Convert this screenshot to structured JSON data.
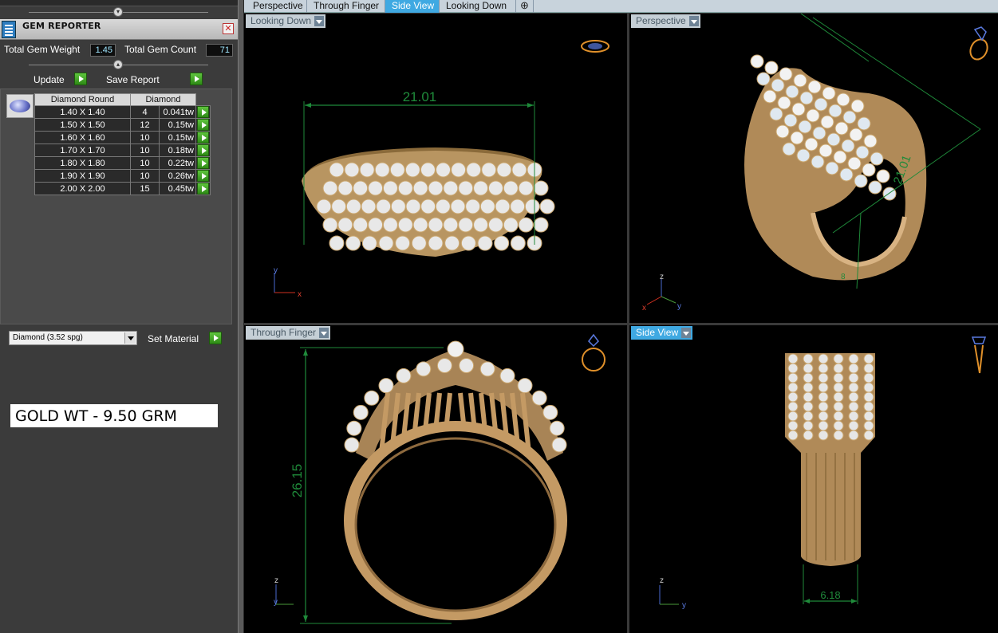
{
  "panel": {
    "title": "GEM REPORTER",
    "close_glyph": "✕",
    "total_weight_label": "Total Gem Weight",
    "total_weight_value": "1.45",
    "total_count_label": "Total Gem Count",
    "total_count_value": "71",
    "update_label": "Update",
    "save_report_label": "Save Report"
  },
  "gem_table": {
    "headers": [
      "Diamond Round",
      "Diamond"
    ],
    "rows": [
      {
        "size": "1.40 X 1.40",
        "count": "4",
        "weight": "0.041tw"
      },
      {
        "size": "1.50 X 1.50",
        "count": "12",
        "weight": "0.15tw"
      },
      {
        "size": "1.60 X 1.60",
        "count": "10",
        "weight": "0.15tw"
      },
      {
        "size": "1.70 X 1.70",
        "count": "10",
        "weight": "0.18tw"
      },
      {
        "size": "1.80 X 1.80",
        "count": "10",
        "weight": "0.22tw"
      },
      {
        "size": "1.90 X 1.90",
        "count": "10",
        "weight": "0.26tw"
      },
      {
        "size": "2.00 X 2.00",
        "count": "15",
        "weight": "0.45tw"
      }
    ]
  },
  "material": {
    "selected": "Diamond     (3.52 spg)",
    "set_label": "Set Material"
  },
  "annotation": "GOLD WT - 9.50 GRM",
  "tabs": [
    {
      "label": "Perspective",
      "active": false
    },
    {
      "label": "Through Finger",
      "active": false
    },
    {
      "label": "Side View",
      "active": true
    },
    {
      "label": "Looking Down",
      "active": false
    }
  ],
  "tab_add_glyph": "⊕",
  "viewports": {
    "top_left": {
      "label": "Looking Down",
      "dimension": "21.01",
      "axis1": "y",
      "axis2": "x"
    },
    "top_right": {
      "label": "Perspective",
      "dimension": "21.01",
      "dimension2": "8",
      "axis1": "z",
      "axis2": "x",
      "axis3": "y"
    },
    "bottom_left": {
      "label": "Through Finger",
      "dimension": "26.15",
      "axis1": "z",
      "axis2": "y"
    },
    "bottom_right": {
      "label": "Side View",
      "dimension": "6.18",
      "axis1": "z",
      "axis2": "y"
    }
  },
  "colors": {
    "gold": "#c9a46e",
    "dimension": "#1f8a3a",
    "active_tab": "#3fa9e2"
  }
}
